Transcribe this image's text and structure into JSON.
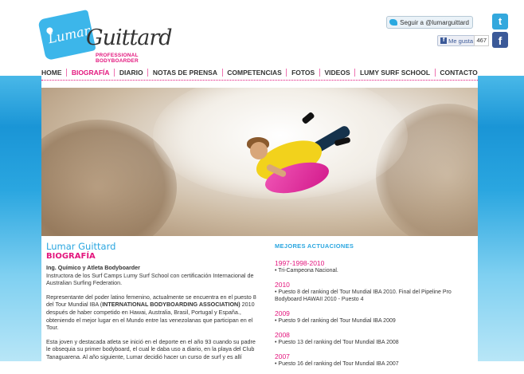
{
  "header": {
    "logo_script": "Lumar",
    "logo_name": "Guittard",
    "logo_tagline": "PROFESSIONAL BODYBOARDER"
  },
  "social": {
    "twitter_label": "Seguir a @lumarguittard",
    "twitter_glyph": "t",
    "fb_like_label": "Me gusta",
    "fb_like_count": "467",
    "fb_glyph": "f"
  },
  "nav": [
    {
      "label": "HOME",
      "active": false
    },
    {
      "label": "BIOGRAFÍA",
      "active": true
    },
    {
      "label": "DIARIO",
      "active": false
    },
    {
      "label": "NOTAS DE PRENSA",
      "active": false
    },
    {
      "label": "COMPETENCIAS",
      "active": false
    },
    {
      "label": "FOTOS",
      "active": false
    },
    {
      "label": "VIDEOS",
      "active": false
    },
    {
      "label": "LUMY SURF SCHOOL",
      "active": false
    },
    {
      "label": "CONTACTO",
      "active": false
    }
  ],
  "bio": {
    "name": "Lumar Guittard",
    "section": "BIOGRAFÍA",
    "subtitle": "Ing. Químico y Atleta Bodyboarder",
    "p1": "Instructora de los Surf Camps Lumy Surf School con certificación Internacional de Australian Surfing Federation.",
    "p2a": "Representante del poder latino femenino, actualmente se encuentra en el puesto 8 del Tour Mundial IBA (",
    "p2b": "INTERNATIONAL BODYBOARDING ASSOCIATION)",
    "p2c": " 2010 después de haber competido en Hawai, Australia, Brasil, Portugal y España., obteniendo el mejor lugar en el Mundo entre las venezolanas que participan en el Tour.",
    "p3": "Esta joven y destacada atleta se inició en el deporte en el año 93 cuando su padre le obsequia su primer bodyboard, el cual le daba uso a diario, en la playa del Club Tanaguarena. Al año siguiente, Lumar decidió hacer un curso de surf y es allí"
  },
  "performances": {
    "heading": "MEJORES ACTUACIONES",
    "entries": [
      {
        "year": "1997-1998-2010",
        "text": "• Tri-Campeona Nacional."
      },
      {
        "year": "2010",
        "text": "• Puesto 8 del ranking del Tour Mundial IBA 2010.  Final del Pipeline Pro Bodyboard HAWAII 2010 - Puesto 4"
      },
      {
        "year": "2009",
        "text": "• Puesto 9 del ranking del Tour Mundial IBA 2009"
      },
      {
        "year": "2008",
        "text": "• Puesto 13 del ranking del Tour Mundial IBA 2008"
      },
      {
        "year": "2007",
        "text": "• Puesto 16 del ranking del Tour Mundial IBA 2007"
      }
    ]
  }
}
